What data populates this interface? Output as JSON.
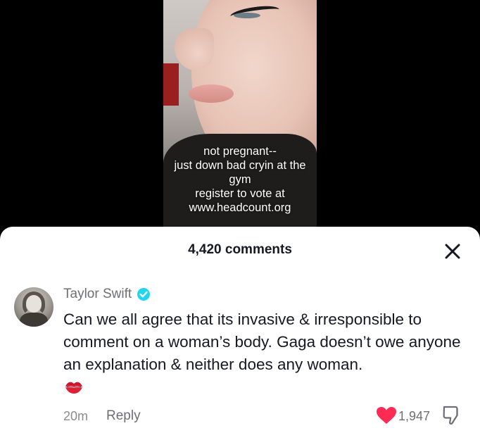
{
  "video": {
    "caption_lines": [
      "not pregnant--",
      "just down bad cryin at the",
      "gym",
      "register to vote at",
      "www.headcount.org"
    ]
  },
  "comments_sheet": {
    "count_label": "4,420 comments",
    "close_icon": "close-icon"
  },
  "comment": {
    "username": "Taylor Swift",
    "verified_icon": "verified-badge-icon",
    "text": "Can we all agree that its invasive & irresponsible to comment on a woman’s body. Gaga doesn’t owe anyone an explanation & neither does any woman.",
    "emoji": "kiss-mark-emoji",
    "time": "20m",
    "reply_label": "Reply",
    "like_count": "1,947",
    "liked": true,
    "like_color": "#fe2c55",
    "verified_color": "#20d5ec"
  }
}
